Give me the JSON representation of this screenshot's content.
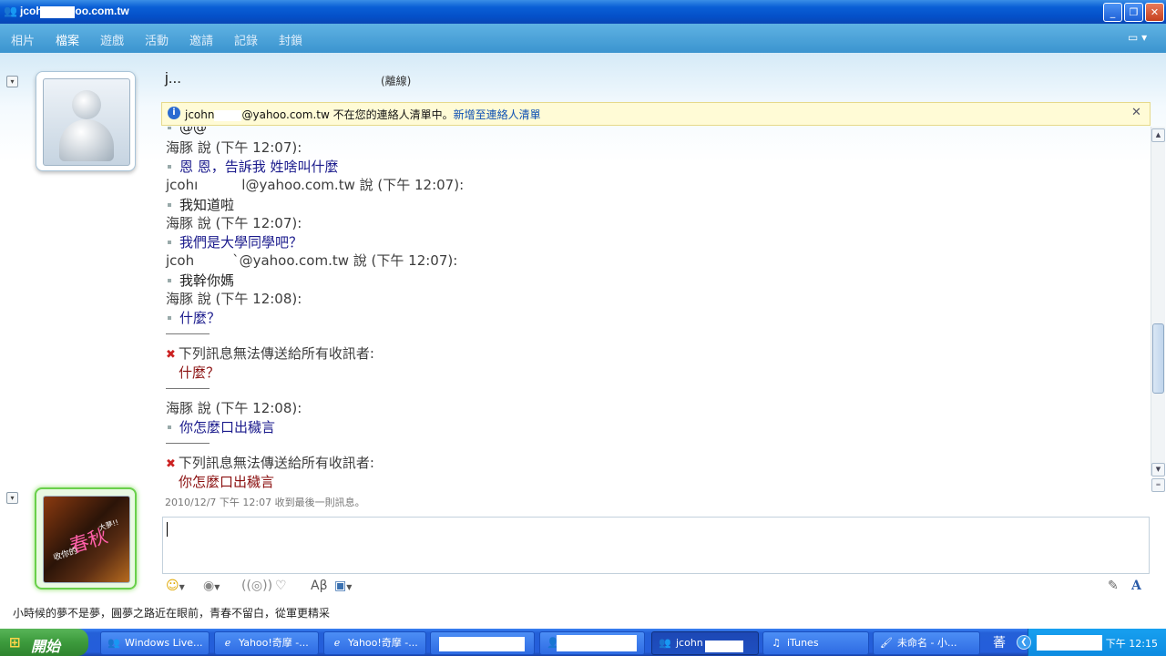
{
  "window": {
    "title": "jcoh        @yahoo.com.tw",
    "buttons": {
      "minimize": "_",
      "restore": "❐",
      "close": "✕"
    }
  },
  "menu": {
    "items": [
      "相片",
      "檔案",
      "遊戲",
      "活動",
      "邀請",
      "記錄",
      "封鎖"
    ],
    "options_icon": "options-dropdown-icon"
  },
  "contact": {
    "name": "j...",
    "status": "(離線)"
  },
  "infobar": {
    "email_prefix": "jcohn",
    "email_suffix": "@yahoo.com.tw",
    "text": " 不在您的連絡人清單中。",
    "link": "新增至連絡人清單",
    "close": "✕"
  },
  "conversation": {
    "partial_top": "@@",
    "entries": [
      {
        "sender": "海豚 說 (下午 12:07):",
        "message": "恩 恩，告訴我 姓啥叫什麼",
        "me": false
      },
      {
        "sender_prefix": "jcohı",
        "sender_suffix": "l@yahoo.com.tw 說 (下午 12:07):",
        "message": "我知道啦",
        "me": true
      },
      {
        "sender": "海豚 說 (下午 12:07):",
        "message": "我們是大學同學吧？",
        "me": false
      },
      {
        "sender_prefix": "jcoh",
        "sender_suffix": "`@yahoo.com.tw 說 (下午 12:07):",
        "message": "我幹你媽",
        "me": true
      },
      {
        "sender": "海豚 說 (下午 12:08):",
        "message": "什麼？",
        "me": false
      }
    ],
    "errors": [
      {
        "notice": "下列訊息無法傳送給所有收訊者:",
        "message": "什麼？"
      },
      {
        "notice": "下列訊息無法傳送給所有收訊者:",
        "message": "你怎麼口出穢言"
      }
    ],
    "entry_after_error": {
      "sender": "海豚 說 (下午 12:08):",
      "message": "你怎麼口出穢言"
    },
    "last_received": "2010/12/7 下午 12:07 收到最後一則訊息。"
  },
  "my_avatar_text": {
    "big": "春秋",
    "small": "收你的",
    "tag": "大夢!!"
  },
  "toolbar": [
    "emoticon-icon",
    "wink-icon",
    "nudge-icon",
    "voice-clip-icon",
    "font-icon",
    "background-icon"
  ],
  "personal_message": "小時候的夢不是夢，圓夢之路近在眼前，青春不留白，從軍更精采",
  "taskbar": {
    "start": "開始",
    "tasks": [
      "Windows Live...",
      "Yahoo!奇摩 -...",
      "Yahoo!奇摩 -...",
      "",
      "",
      "jcohn",
      "iTunes",
      "未命名 - 小..."
    ],
    "ime": "萫",
    "clock": "下午 12:15"
  }
}
